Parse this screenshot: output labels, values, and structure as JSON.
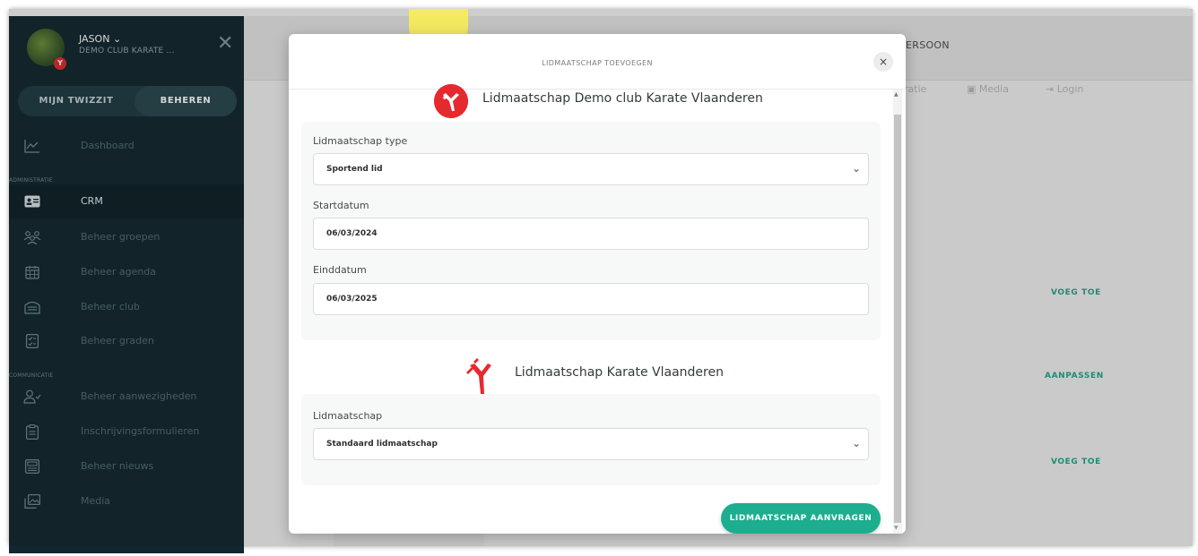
{
  "sidebar": {
    "user_name": "JASON ⌄",
    "user_club": "DEMO CLUB KARATE ...",
    "tabs": [
      "MIJN TWIZZIT",
      "BEHEREN"
    ],
    "sections": {
      "administratie": "ADMINISTRATIE",
      "communicatie": "COMMUNICATIE"
    },
    "items": [
      {
        "label": "Dashboard",
        "icon": "chart-line-icon"
      },
      {
        "label": "CRM",
        "icon": "id-card-icon"
      },
      {
        "label": "Beheer groepen",
        "icon": "users-group-icon"
      },
      {
        "label": "Beheer agenda",
        "icon": "calendar-icon"
      },
      {
        "label": "Beheer club",
        "icon": "building-icon"
      },
      {
        "label": "Beheer graden",
        "icon": "checklist-icon"
      },
      {
        "label": "Beheer aanwezigheden",
        "icon": "user-check-icon"
      },
      {
        "label": "Inschrijvingsformulieren",
        "icon": "clipboard-icon"
      },
      {
        "label": "Beheer nieuws",
        "icon": "newspaper-icon"
      },
      {
        "label": "Media",
        "icon": "images-icon"
      }
    ]
  },
  "background": {
    "persoon_label": "ERSOON",
    "submenu": [
      "ratie",
      "Media",
      "Login"
    ],
    "actions": [
      "VOEG TOE",
      "AANPASSEN",
      "VOEG TOE"
    ]
  },
  "modal": {
    "title": "LIDMAATSCHAP TOEVOEGEN",
    "close": "×",
    "club_section_title": "Lidmaatschap Demo club Karate Vlaanderen",
    "fields": {
      "type_label": "Lidmaatschap type",
      "type_value": "Sportend lid",
      "start_label": "Startdatum",
      "start_value": "06/03/2024",
      "end_label": "Einddatum",
      "end_value": "06/03/2025"
    },
    "federation_section_title": "Lidmaatschap Karate Vlaanderen",
    "federation": {
      "label": "Lidmaatschap",
      "value": "Standaard lidmaatschap"
    },
    "submit_label": "LIDMAATSCHAP AANVRAGEN"
  },
  "colors": {
    "accent": "#1cae8e",
    "sidebar_bg": "#10272e",
    "brand_red": "#e52a2f"
  }
}
